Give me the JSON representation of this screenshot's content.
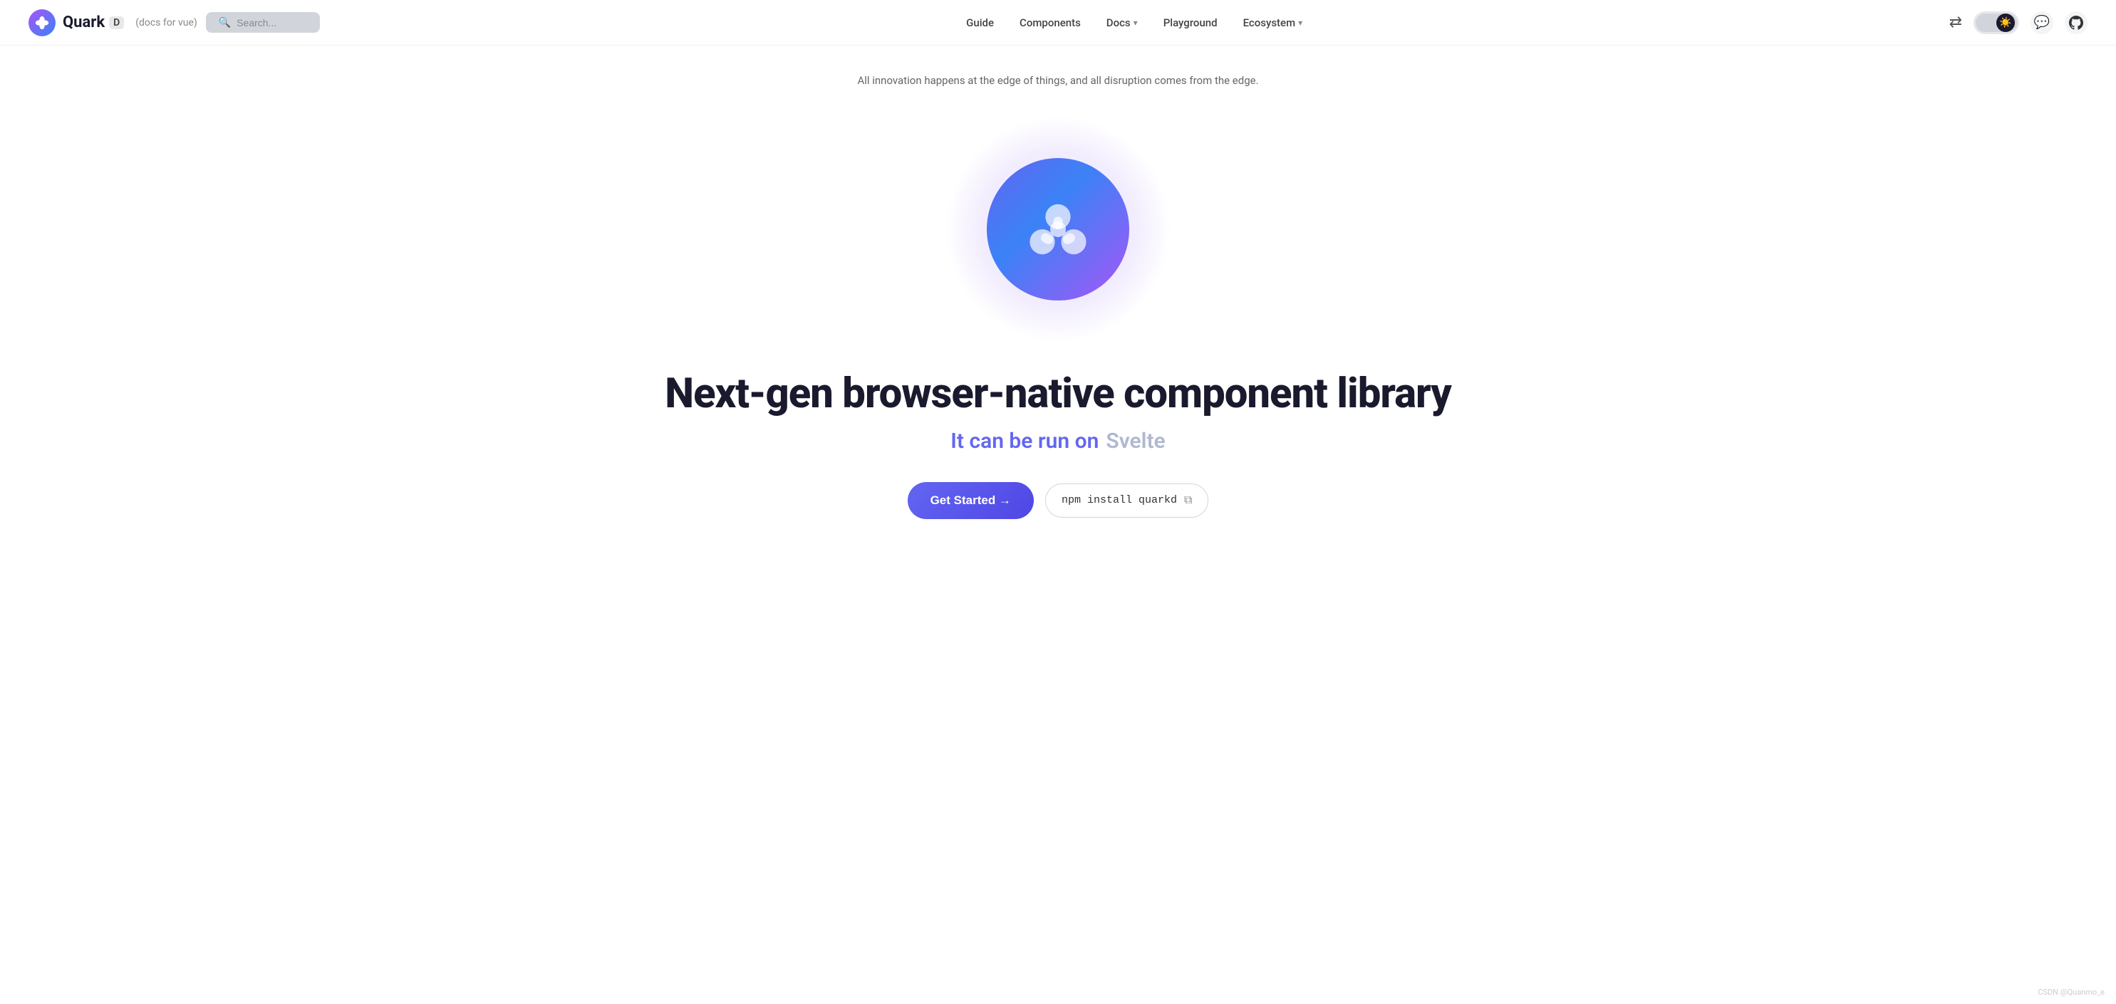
{
  "brand": {
    "logo_alt": "Quark logo",
    "name": "Quark",
    "badge": "D",
    "subtitle": "(docs for vue)"
  },
  "navbar": {
    "search_placeholder": "Search...",
    "links": [
      {
        "label": "Guide",
        "has_dropdown": false
      },
      {
        "label": "Components",
        "has_dropdown": false
      },
      {
        "label": "Docs",
        "has_dropdown": true
      },
      {
        "label": "Playground",
        "has_dropdown": false
      },
      {
        "label": "Ecosystem",
        "has_dropdown": true
      }
    ],
    "theme_label": "theme-toggle",
    "translate_label": "translate",
    "github_label": "GitHub",
    "chat_label": "chat"
  },
  "hero": {
    "tagline": "All innovation happens at the edge of things, and all disruption comes from the edge.",
    "headline": "Next-gen browser-native component library",
    "subtitle_main": "It can be run on",
    "subtitle_framework": "Svelte",
    "cta_button": "Get Started →",
    "npm_command": "npm install quarkd",
    "copy_tooltip": "Copy"
  },
  "footer": {
    "watermark": "CSDN @Quanmo_e"
  }
}
